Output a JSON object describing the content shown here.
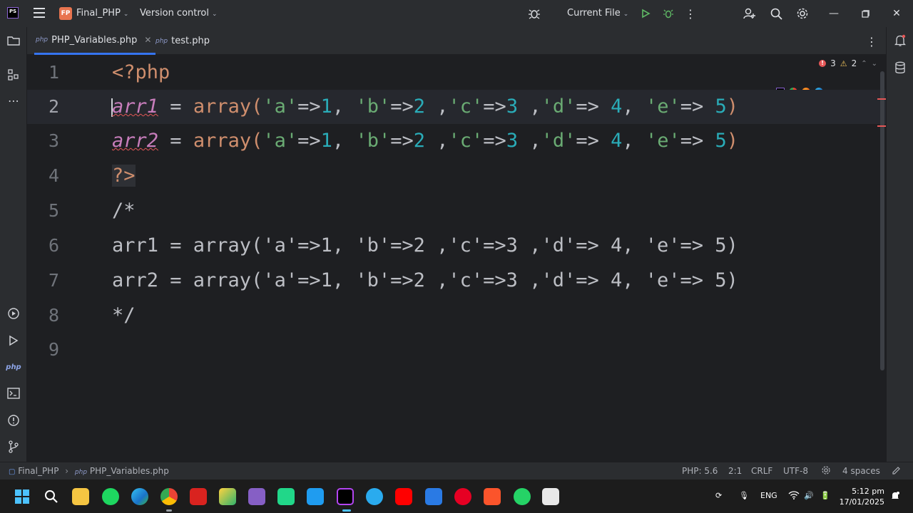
{
  "titlebar": {
    "app_logo": "PS",
    "project_initials": "FP",
    "project_name": "Final_PHP",
    "vcs_label": "Version control",
    "run_config": "Current File"
  },
  "tabs": [
    {
      "icon": "php",
      "label": "PHP_Variables.php",
      "active": true
    },
    {
      "icon": "php",
      "label": "test.php",
      "active": false
    }
  ],
  "inspections": {
    "errors": "3",
    "warnings": "2"
  },
  "editor": {
    "current_line": 2,
    "lines": [
      {
        "num": "1"
      },
      {
        "num": "2"
      },
      {
        "num": "3"
      },
      {
        "num": "4"
      },
      {
        "num": "5"
      },
      {
        "num": "6"
      },
      {
        "num": "7"
      },
      {
        "num": "8"
      },
      {
        "num": "9"
      }
    ],
    "code": {
      "l1": "<?php",
      "l2_var": "arr1",
      "l3_var": "arr2",
      "assign": " = ",
      "fn": "array(",
      "a_key": "'a'",
      "b_key": "'b'",
      "c_key": "'c'",
      "d_key": "'d'",
      "e_key": "'e'",
      "arrow": "=>",
      "n1": "1",
      "n2": "2",
      "n3": "3",
      "n4": "4",
      "n5": "5",
      "comma_sp": ", ",
      "sp_comma": " ,",
      "arrow_sp": "=> ",
      "close_paren": ")",
      "l4": "?>",
      "l5": "/*",
      "l6": "arr1 = array('a'=>1, 'b'=>2 ,'c'=>3 ,'d'=> 4, 'e'=> 5)",
      "l7": "arr2 = array('a'=>1, 'b'=>2 ,'c'=>3 ,'d'=> 4, 'e'=> 5)",
      "l8": "*/"
    }
  },
  "statusbar": {
    "breadcrumb_project": "Final_PHP",
    "breadcrumb_file": "PHP_Variables.php",
    "php_level": "PHP: 5.6",
    "position": "2:1",
    "line_sep": "CRLF",
    "encoding": "UTF-8",
    "indent": "4 spaces"
  },
  "taskbar": {
    "lang": "ENG",
    "time": "5:12 pm",
    "date": "17/01/2025"
  },
  "colors": {
    "keyword": "#cf8e6d",
    "variable": "#c77dbb",
    "string": "#6aab73",
    "number": "#2aacb8",
    "error": "#e55757",
    "accent": "#3574f0"
  }
}
